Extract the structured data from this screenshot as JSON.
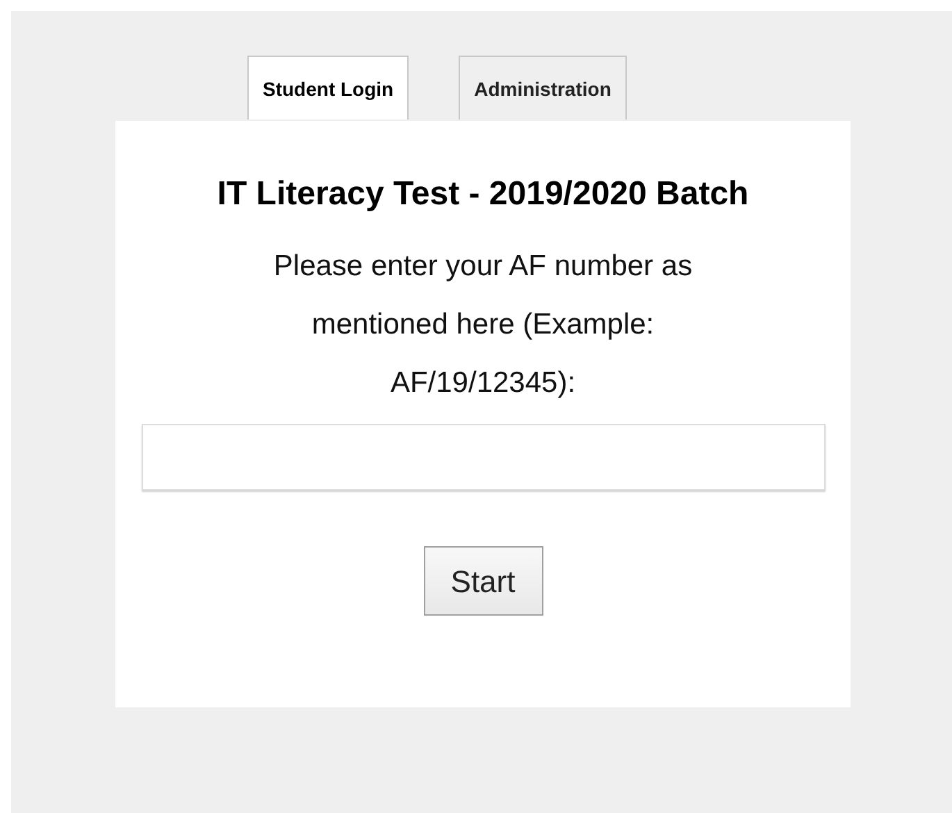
{
  "tabs": [
    {
      "label": "Student Login",
      "selected": true
    },
    {
      "label": "Administration",
      "selected": false
    }
  ],
  "title": "IT Literacy Test - 2019/2020 Batch",
  "instruction": "Please enter your AF number as mentioned here (Example: AF/19/12345):",
  "start_button": "Start"
}
